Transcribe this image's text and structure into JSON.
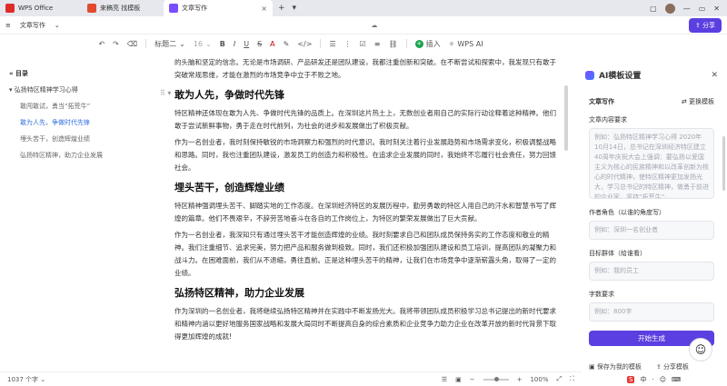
{
  "tabs": [
    {
      "label": "WPS Office",
      "color": "#e02b2b"
    },
    {
      "label": "来稿亮 找模板",
      "color": "#e24a2f"
    },
    {
      "label": "文章写作",
      "color": "#7a4dff"
    }
  ],
  "titlebar_right": [
    "+",
    "▾"
  ],
  "menubar": {
    "doc_title": "文章写作",
    "share_label": "分享"
  },
  "toolbar": {
    "style_select": "标题二",
    "font_size": "16",
    "insert_label": "插入",
    "wps_ai_label": "WPS AI"
  },
  "outline": {
    "title": "目录",
    "items": [
      {
        "label": "弘扬特区精神学习心得",
        "level": 1,
        "active": false
      },
      {
        "label": "敢闯敢试，勇当“拓荒牛”",
        "level": 2,
        "active": false
      },
      {
        "label": "敢为人先，争做时代先锋",
        "level": 2,
        "active": true
      },
      {
        "label": "埋头苦干，创造辉煌业绩",
        "level": 2,
        "active": false
      },
      {
        "label": "弘扬特区精神，助力企业发展",
        "level": 2,
        "active": false
      }
    ]
  },
  "document": {
    "intro": "的头脑和坚定的信念。无论是市场调研、产品研发还是团队建设，我都注重创新和突破。在不断尝试和探索中，我发现只有敢于突破常规思维，才能在激烈的市场竞争中立于不败之地。",
    "sections": [
      {
        "heading": "敢为人先，争做时代先锋",
        "paragraphs": [
          "特区精神还体现在敢为人先、争做时代先锋的品质上。在深圳这片热土上，无数创业者用自己的实际行动诠释着这种精神。他们敢于尝试新鲜事物，勇于走在时代前列，为社会的进步和发展做出了积极贡献。",
          "作为一名创业者，我时刻保持敏锐的市场洞察力和强烈的时代意识。我时刻关注着行业发展趋势和市场需求变化，积极调整战略和思路。同时，我也注重团队建设，激发员工的创造力和积极性。在追求企业发展的同时，我始终不忘履行社会责任，努力回馈社会。"
        ]
      },
      {
        "heading": "埋头苦干，创造辉煌业绩",
        "paragraphs": [
          "特区精神强调埋头苦干、脚踏实地的工作态度。在深圳经济特区的发展历程中，勤劳勇敢的特区人用自己的汗水和智慧书写了辉煌的篇章。他们不畏艰辛，不辞劳苦地奋斗在各自的工作岗位上，为特区的繁荣发展做出了巨大贡献。",
          "作为一名创业者，我深知只有通过埋头苦干才能创造辉煌的业绩。我时刻要求自己和团队成员保持务实的工作态度和敬业的精神。我们注重细节、追求完美，努力把产品和服务做到极致。同时，我们还积极加强团队建设和员工培训，提高团队的凝聚力和战斗力。在困难面前，我们从不退缩，勇往直前。正是这种埋头苦干的精神，让我们在市场竞争中逐渐崭露头角，取得了一定的业绩。"
        ]
      },
      {
        "heading": "弘扬特区精神，助力企业发展",
        "paragraphs": [
          "作为深圳的一名创业者，我将继续弘扬特区精神并在实践中不断发扬光大。我将带领团队成员积极学习总书记提出的新时代要求和精神内涵以更好地服务国家战略和发展大局同时不断提高自身的综合素质和企业竞争力助力企业在改革开放的新时代背景下取得更加辉煌的成就!"
        ]
      }
    ]
  },
  "statusbar": {
    "word_count": "1037 个字",
    "zoom": "100%"
  },
  "panel": {
    "title": "AI模板设置",
    "section_label": "文章写作",
    "switch_label": "更换模板",
    "content_label": "文章内容要求",
    "content_placeholder": "例如：弘扬特区精神学习心得 2020年10月14日，总书记在深圳经济特区建立40周年庆祝大会上强调：要弘扬以爱国主义为核心的民族精神和以改革创新为核心的时代精神，使特区精神更加发扬光大，学习总书记的特区精神，做勇于前进的企业家，坚持“拓荒牛”。",
    "role_label": "作者角色（以谁的角度写）",
    "role_placeholder": "例如：深圳一名创业者",
    "audience_label": "目标群体（给谁看）",
    "audience_placeholder": "例如：我的员工",
    "words_label": "字数要求",
    "words_placeholder": "例如：800字",
    "generate_label": "开始生成",
    "save_label": "保存为我的模板",
    "share_label": "分享模板"
  },
  "tray": [
    "中",
    "·",
    "☺",
    "⌨"
  ],
  "colors": {
    "accent": "#5b3fe0",
    "link": "#2f6fe0"
  }
}
